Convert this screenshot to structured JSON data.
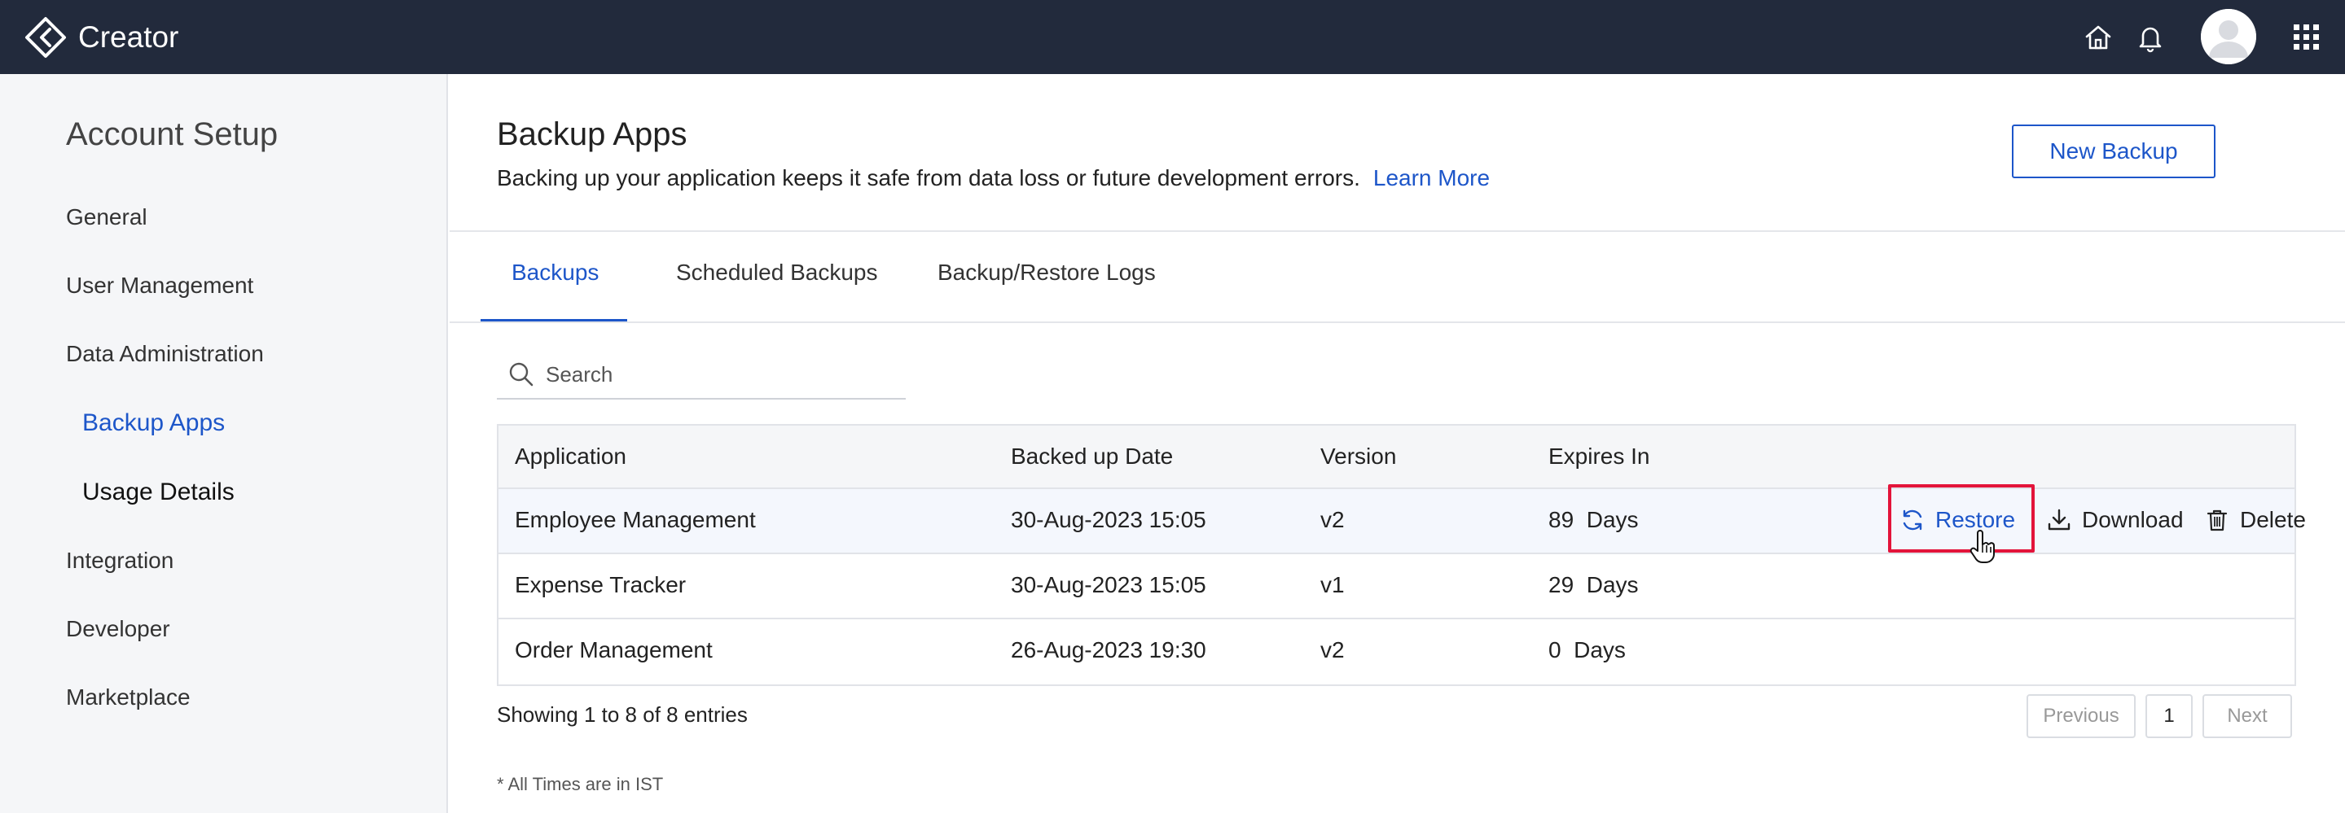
{
  "app": {
    "name": "Creator"
  },
  "topbar": {
    "icons": [
      "home-icon",
      "bell-icon",
      "avatar",
      "apps-grid-icon"
    ]
  },
  "sidebar": {
    "title": "Account Setup",
    "items": [
      {
        "label": "General"
      },
      {
        "label": "User Management"
      },
      {
        "label": "Data Administration"
      },
      {
        "label": "Backup Apps",
        "active": true
      },
      {
        "label": "Usage Details"
      },
      {
        "label": "Integration"
      },
      {
        "label": "Developer"
      },
      {
        "label": "Marketplace"
      }
    ]
  },
  "header": {
    "title": "Backup Apps",
    "description": "Backing up your application keeps it safe from data loss or future development errors.",
    "learn_more": "Learn More",
    "new_backup": "New Backup"
  },
  "tabs": [
    {
      "label": "Backups",
      "active": true
    },
    {
      "label": "Scheduled Backups"
    },
    {
      "label": "Backup/Restore Logs"
    }
  ],
  "search": {
    "placeholder": "Search"
  },
  "table": {
    "columns": [
      "Application",
      "Backed up Date",
      "Version",
      "Expires In"
    ],
    "rows": [
      {
        "application": "Employee Management",
        "date": "30-Aug-2023 15:05",
        "version": "v2",
        "expires_num": "89",
        "expires_unit": "Days"
      },
      {
        "application": "Expense Tracker",
        "date": "30-Aug-2023 15:05",
        "version": "v1",
        "expires_num": "29",
        "expires_unit": "Days"
      },
      {
        "application": "Order Management",
        "date": "26-Aug-2023 19:30",
        "version": "v2",
        "expires_num": "0",
        "expires_unit": "Days"
      }
    ],
    "actions": {
      "restore": "Restore",
      "download": "Download",
      "delete": "Delete"
    }
  },
  "pagination": {
    "summary": "Showing 1 to 8 of 8 entries",
    "previous": "Previous",
    "current": "1",
    "next": "Next"
  },
  "footnote": "* All Times are in IST",
  "colors": {
    "topbar": "#222a3c",
    "accent": "#1d56c9",
    "highlight": "#e3143a"
  }
}
